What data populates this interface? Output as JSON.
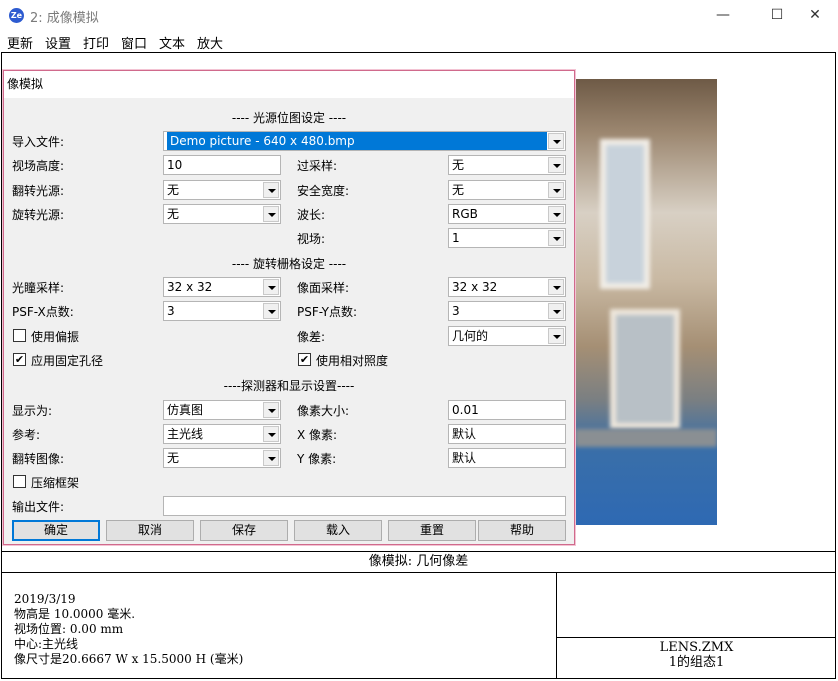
{
  "window": {
    "icon_text": "Ze",
    "title": "2: 成像模拟",
    "minimize": "—",
    "maximize": "☐",
    "close": "✕"
  },
  "menu": [
    "更新",
    "设置",
    "打印",
    "窗口",
    "文本",
    "放大"
  ],
  "dialog": {
    "title": "像模拟",
    "section_source": "---- 光源位图设定 ----",
    "section_grid": "---- 旋转栅格设定 ----",
    "section_detector": "----探测器和显示设置----",
    "import_file_label": "导入文件:",
    "import_file_value": "Demo picture -  640 x 480.bmp",
    "field_height_label": "视场高度:",
    "field_height_value": "10",
    "oversample_label": "过采样:",
    "oversample_value": "无",
    "flip_source_label": "翻转光源:",
    "flip_source_value": "无",
    "guard_band_label": "安全宽度:",
    "guard_band_value": "无",
    "rotate_source_label": "旋转光源:",
    "rotate_source_value": "无",
    "wavelength_label": "波长:",
    "wavelength_value": "RGB",
    "field_label": "视场:",
    "field_value": "1",
    "pupil_sampling_label": "光瞳采样:",
    "pupil_sampling_value": "32 x 32",
    "image_sampling_label": "像面采样:",
    "image_sampling_value": "32 x 32",
    "psf_x_label": "PSF-X点数:",
    "psf_x_value": "3",
    "psf_y_label": "PSF-Y点数:",
    "psf_y_value": "3",
    "use_polarization_label": "使用偏振",
    "use_polarization_checked": false,
    "aberration_label": "像差:",
    "aberration_value": "几何的",
    "fixed_aperture_label": "应用固定孔径",
    "fixed_aperture_checked": true,
    "relative_illum_label": "使用相对照度",
    "relative_illum_checked": true,
    "show_as_label": "显示为:",
    "show_as_value": "仿真图",
    "pixel_size_label": "像素大小:",
    "pixel_size_value": "0.01",
    "reference_label": "参考:",
    "reference_value": "主光线",
    "x_pixels_label": "X 像素:",
    "x_pixels_value": "默认",
    "flip_image_label": "翻转图像:",
    "flip_image_value": "无",
    "y_pixels_label": "Y 像素:",
    "y_pixels_value": "默认",
    "compress_frame_label": "压缩框架",
    "compress_frame_checked": false,
    "output_file_label": "输出文件:",
    "output_file_value": "",
    "buttons": {
      "ok": "确定",
      "cancel": "取消",
      "save": "保存",
      "load": "载入",
      "reset": "重置",
      "help": "帮助"
    }
  },
  "caption": "像模拟: 几何像差",
  "info_lines": [
    "2019/3/19",
    "物高是 10.0000 毫米.",
    "视场位置: 0.00 mm",
    "中心:主光线",
    "像尺寸是20.6667 W x 15.5000 H (毫米)"
  ],
  "lens_file": "LENS.ZMX",
  "config": "1的组态1"
}
